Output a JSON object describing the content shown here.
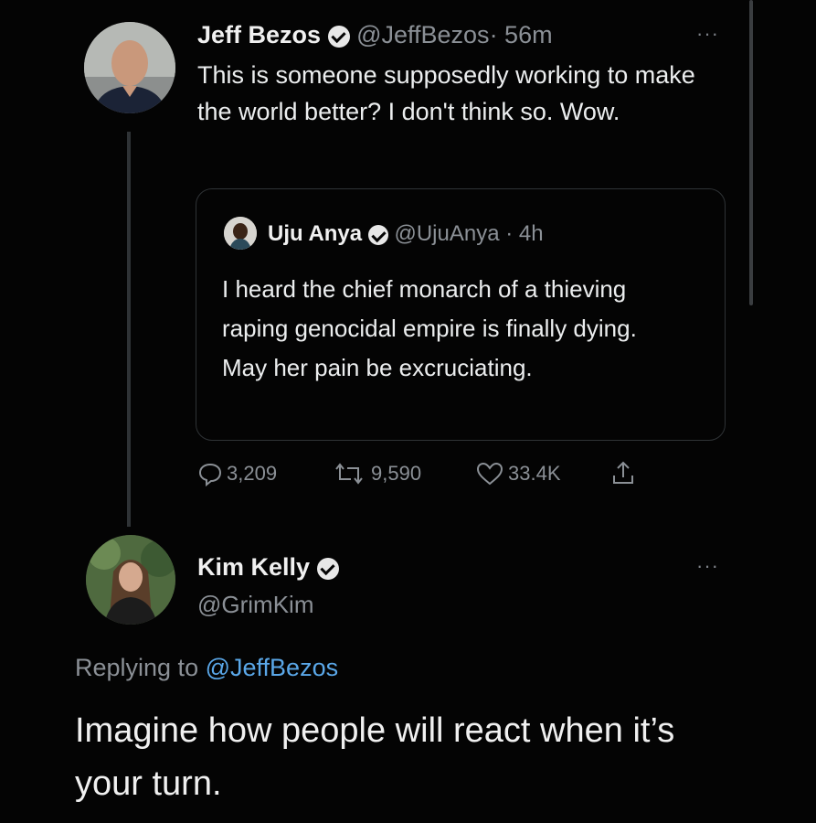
{
  "tweet1": {
    "name": "Jeff Bezos",
    "handle": "@JeffBezos",
    "time": "· 56m",
    "more": "···",
    "text": "This is someone supposedly working to make the world better? I don't think so. Wow.",
    "quoted": {
      "name": "Uju Anya",
      "handle": "@UjuAnya",
      "time": "· 4h",
      "text": "I heard the chief monarch of a thieving raping genocidal empire is finally dying. May her pain be excruciating."
    },
    "actions": {
      "replies": "3,209",
      "retweets": "9,590",
      "likes": "33.4K",
      "icons": [
        "reply-icon",
        "retweet-icon",
        "like-icon",
        "share-icon"
      ]
    }
  },
  "tweet2": {
    "name": "Kim Kelly",
    "handle": "@GrimKim",
    "more": "···",
    "replying_prefix": "Replying to",
    "replying_handle": "@JeffBezos",
    "text": "Imagine how people will react when it’s your turn."
  },
  "colors": {
    "background": "#040404",
    "text": "#e7e9ea",
    "muted": "#8b9096",
    "link": "#5aa7e8"
  }
}
